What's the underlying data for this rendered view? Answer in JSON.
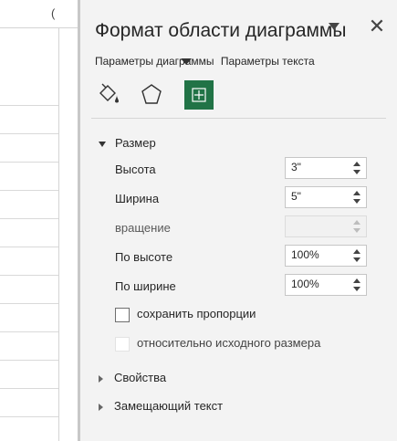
{
  "pane": {
    "title": "Формат области диаграммы",
    "tabs": [
      "Параметры диаграммы",
      "Параметры текста"
    ],
    "icons": [
      "fill-line-icon",
      "effects-icon",
      "size-properties-icon"
    ]
  },
  "size_section": {
    "header": "Размер",
    "rows": [
      {
        "label": "Высота",
        "value": "3\""
      },
      {
        "label": "Ширина",
        "value": "5\""
      },
      {
        "label": "вращение",
        "value": ""
      },
      {
        "label": "По высоте",
        "value": "100%"
      },
      {
        "label": "По ширине",
        "value": "100%"
      }
    ],
    "lock_aspect": "сохранить пропорции",
    "relative_original": "относительно исходного размера"
  },
  "properties_section": {
    "header": "Свойства"
  },
  "alt_text_section": {
    "header": "Замещающий текст"
  },
  "colors": {
    "accent": "#217346",
    "pane_bg": "#f3f3f3"
  }
}
